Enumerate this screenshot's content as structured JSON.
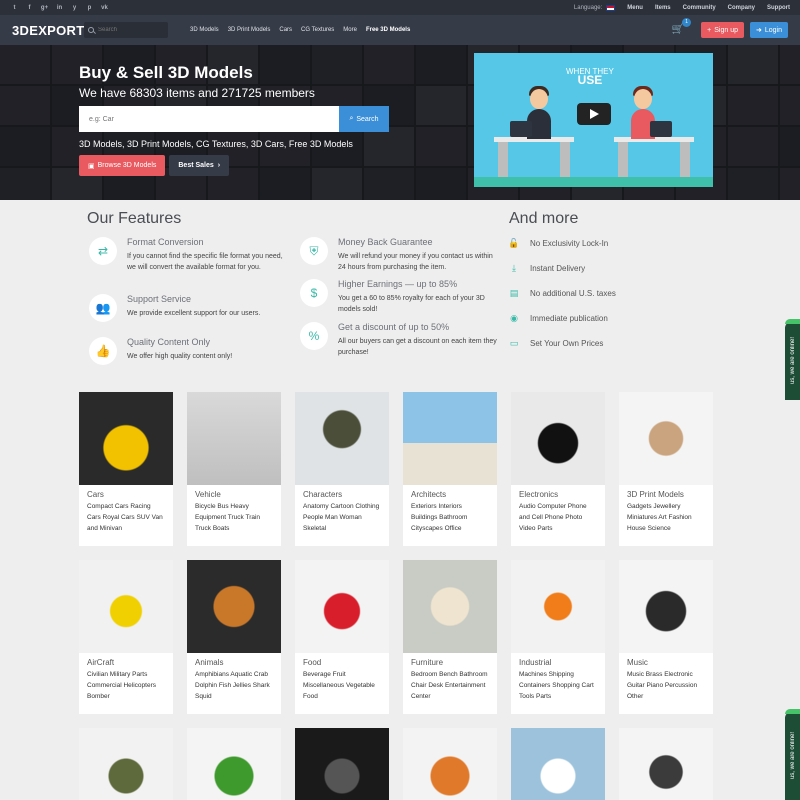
{
  "topbar": {
    "social": [
      "t",
      "f",
      "g+",
      "in",
      "y",
      "p",
      "vk"
    ],
    "language_label": "Language:",
    "links": [
      "Menu",
      "Items",
      "Community",
      "Company",
      "Support"
    ]
  },
  "nav": {
    "logo": "3DEXPORT",
    "search_placeholder": "Search",
    "links": [
      "3D Models",
      "3D Print Models",
      "Cars",
      "CG Textures",
      "More",
      "Free 3D Models"
    ],
    "cart_count": "1",
    "signup": "Sign up",
    "login": "Login"
  },
  "hero": {
    "title": "Buy & Sell 3D Models",
    "subtitle": "We have 68303 items and 271725 members",
    "search_placeholder": "e.g: Car",
    "search_button": "Search",
    "categories_line": "3D Models, 3D Print Models, CG Textures, 3D Cars, Free 3D Models",
    "browse_button": "Browse 3D Models",
    "best_sales_button": "Best Sales",
    "video_caption_top": "WHEN THEY",
    "video_caption_bottom": "USE"
  },
  "features": {
    "heading": "Our Features",
    "items": [
      {
        "title": "Format Conversion",
        "desc": "If you cannot find the specific file format you need, we will convert the available format for you.",
        "icon": "arrows-icon"
      },
      {
        "title": "Support Service",
        "desc": "We provide excellent support for our users.",
        "icon": "users-icon"
      },
      {
        "title": "Quality Content Only",
        "desc": "We offer high quality content only!",
        "icon": "thumbs-up-icon"
      },
      {
        "title": "Money Back Guarantee",
        "desc": "We will refund your money if you contact us within 24 hours from purchasing the item.",
        "icon": "shield-icon"
      },
      {
        "title": "Higher Earnings — up to 85%",
        "desc": "You get a 60 to 85% royalty for each of your 3D models sold!",
        "icon": "dollar-icon"
      },
      {
        "title": "Get a discount of up to 50%",
        "desc": "All our buyers can get a discount on each item they purchase!",
        "icon": "tag-icon"
      }
    ]
  },
  "more": {
    "heading": "And more",
    "items": [
      "No Exclusivity Lock-In",
      "Instant Delivery",
      "No additional U.S. taxes",
      "Immediate publication",
      "Set Your Own Prices"
    ]
  },
  "categories": [
    {
      "name": "Cars",
      "desc": "Compact Cars Racing Cars Royal Cars SUV Van and Minivan"
    },
    {
      "name": "Vehicle",
      "desc": "Bicycle Bus Heavy Equipment Truck Train Truck Boats"
    },
    {
      "name": "Characters",
      "desc": "Anatomy Cartoon Clothing People Man Woman Skeletal"
    },
    {
      "name": "Architects",
      "desc": "Exteriors Interiors Buildings Bathroom Cityscapes Office"
    },
    {
      "name": "Electronics",
      "desc": "Audio Computer Phone and Cell Phone Photo Video Parts"
    },
    {
      "name": "3D Print Models",
      "desc": "Gadgets Jewellery Miniatures Art Fashion House Science"
    },
    {
      "name": "AirCraft",
      "desc": "Civilian Military Parts Commercial Helicopters Bomber"
    },
    {
      "name": "Animals",
      "desc": "Amphibians Aquatic Crab Dolphin Fish Jellies Shark Squid"
    },
    {
      "name": "Food",
      "desc": "Beverage Fruit Miscellaneous Vegetable Food"
    },
    {
      "name": "Furniture",
      "desc": "Bedroom Bench Bathroom Chair Desk Entertainment Center"
    },
    {
      "name": "Industrial",
      "desc": "Machines Shipping Containers Shopping Cart Tools Parts"
    },
    {
      "name": "Music",
      "desc": "Music Brass Electronic Guitar Piano Percussion Other"
    }
  ],
  "online_tab": "us, we are online!",
  "colors": {
    "accent": "#38b9a8",
    "signup": "#e85a5f",
    "login": "#3a8fd8",
    "nav": "#363b48"
  }
}
